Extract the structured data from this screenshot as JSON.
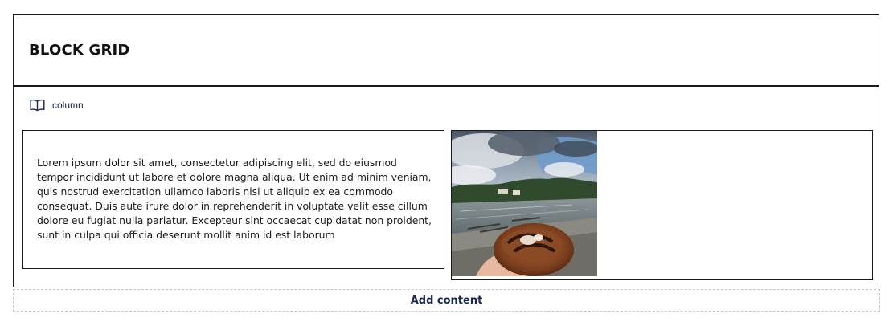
{
  "block_grid": {
    "title": "BLOCK GRID",
    "area": {
      "icon": "book-icon",
      "label": "column"
    },
    "text_block": {
      "body": "Lorem ipsum dolor sit amet, consectetur adipiscing elit, sed do eiusmod tempor incididunt ut labore et dolore magna aliqua. Ut enim ad minim veniam, quis nostrud exercitation ullamco laboris nisi ut aliquip ex ea commodo consequat. Duis aute irure dolor in reprehenderit in voluptate velit esse cillum dolore eu fugiat nulla pariatur. Excepteur sint occaecat cupidatat non proident, sunt in culpa qui officia deserunt mollit anim id est laborum"
    },
    "image_block": {
      "image": "photo-lakeside-pastry"
    }
  },
  "add_content_label": "Add content",
  "colors": {
    "accent": "#1b264f",
    "border": "#1a1a1a",
    "dashed_border": "#c4c4c4"
  }
}
